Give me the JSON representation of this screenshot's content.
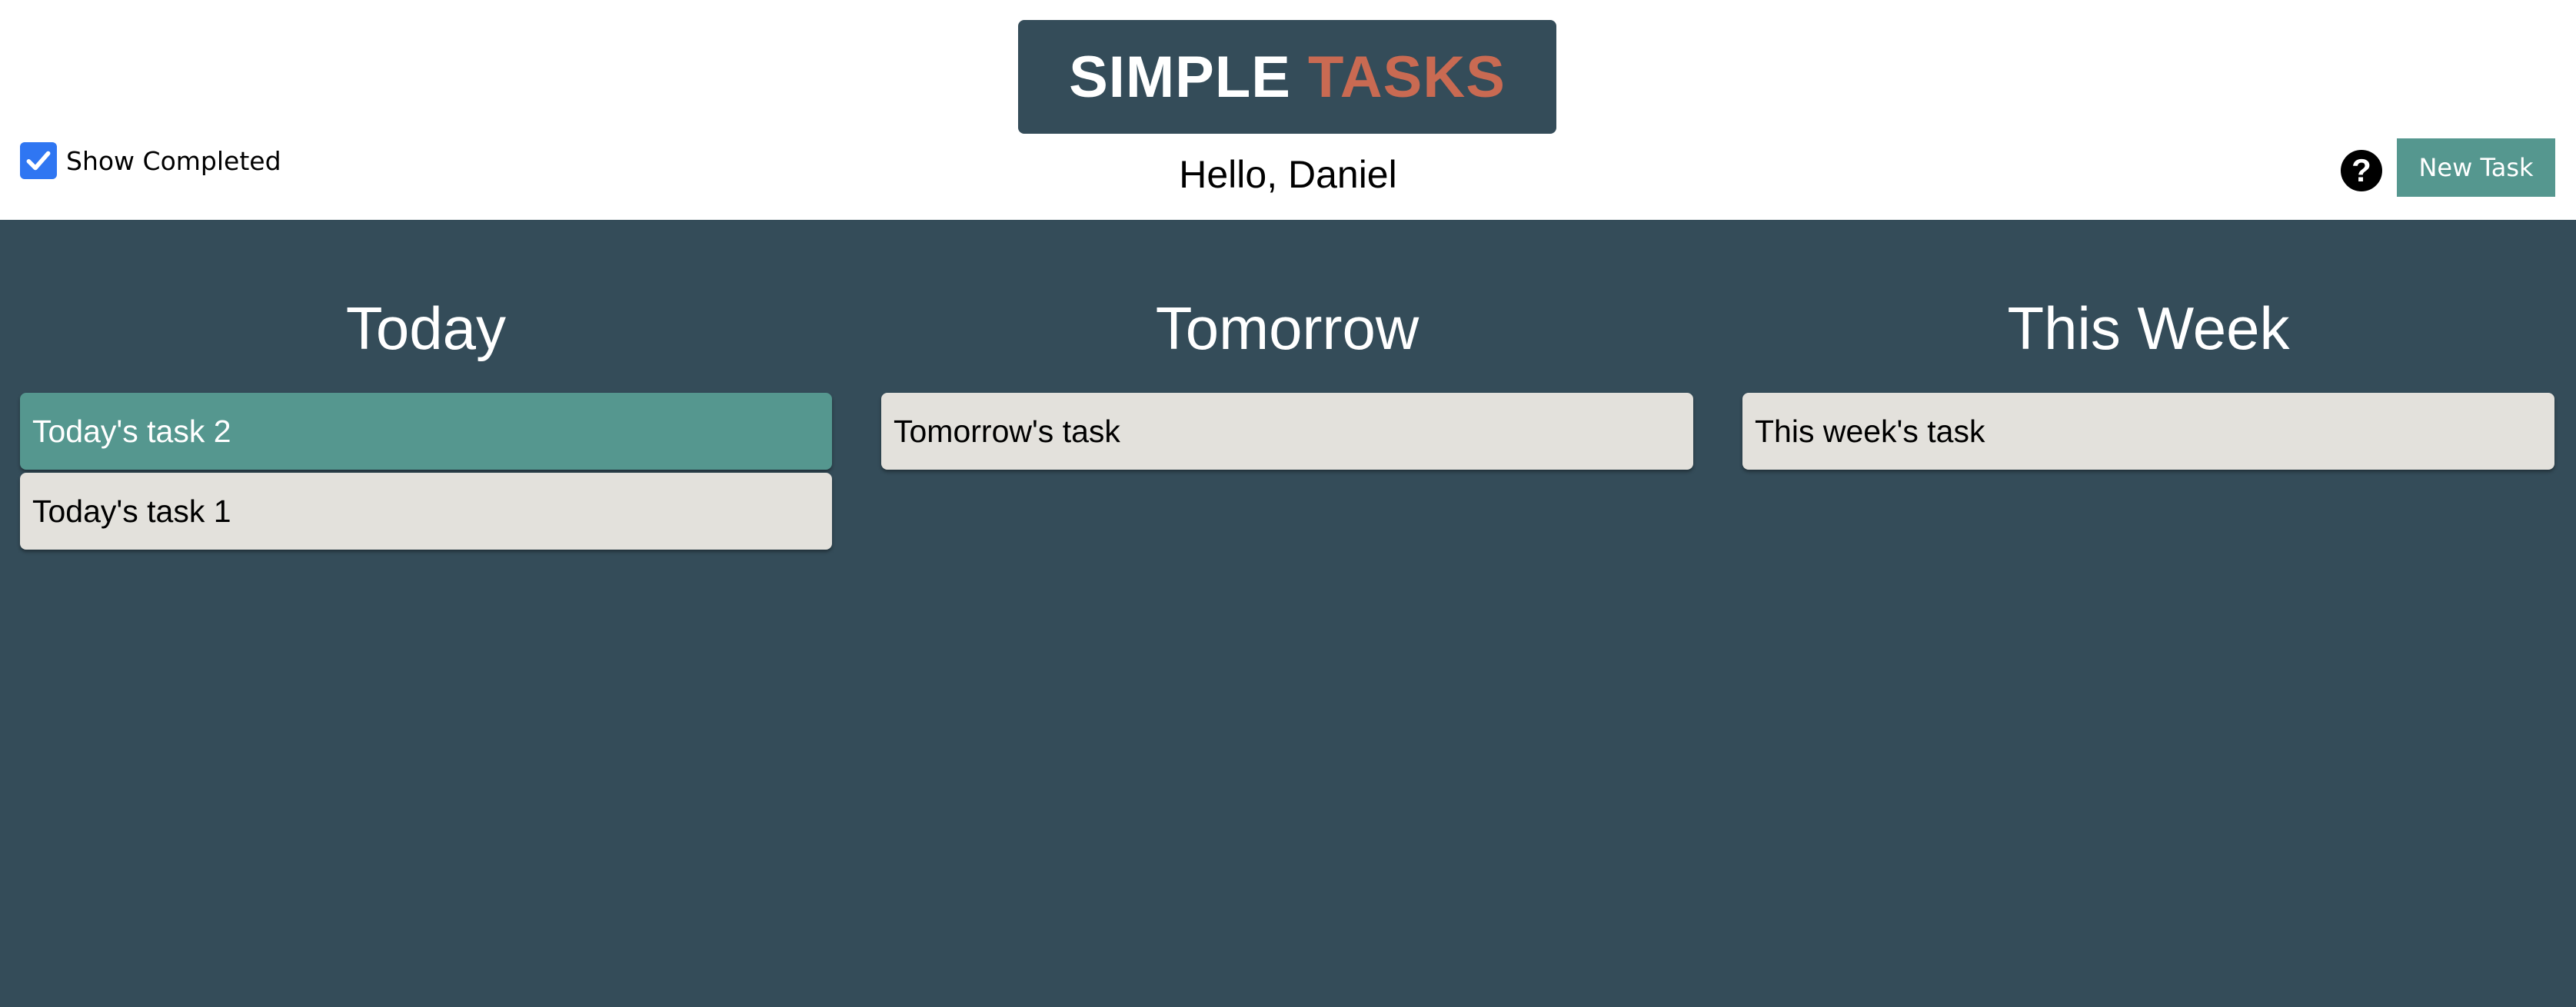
{
  "app": {
    "logo_word1": "SIMPLE",
    "logo_word2": "TASKS",
    "greeting": "Hello, Daniel"
  },
  "toolbar": {
    "show_completed_label": "Show Completed",
    "show_completed_checked": true,
    "help_icon": "?",
    "new_task_label": "New Task"
  },
  "columns": [
    {
      "title": "Today",
      "tasks": [
        {
          "label": "Today's task 2",
          "selected": true
        },
        {
          "label": "Today's task 1",
          "selected": false
        }
      ]
    },
    {
      "title": "Tomorrow",
      "tasks": [
        {
          "label": "Tomorrow's task",
          "selected": false
        }
      ]
    },
    {
      "title": "This Week",
      "tasks": [
        {
          "label": "This week's task",
          "selected": false
        }
      ]
    }
  ],
  "colors": {
    "header_bg": "#ffffff",
    "board_bg": "#344c59",
    "logo_accent": "#c96a52",
    "button_bg": "#55978f",
    "task_bg": "#e3e1dc",
    "task_selected_bg": "#55978f",
    "checkbox_bg": "#2f76f2"
  }
}
